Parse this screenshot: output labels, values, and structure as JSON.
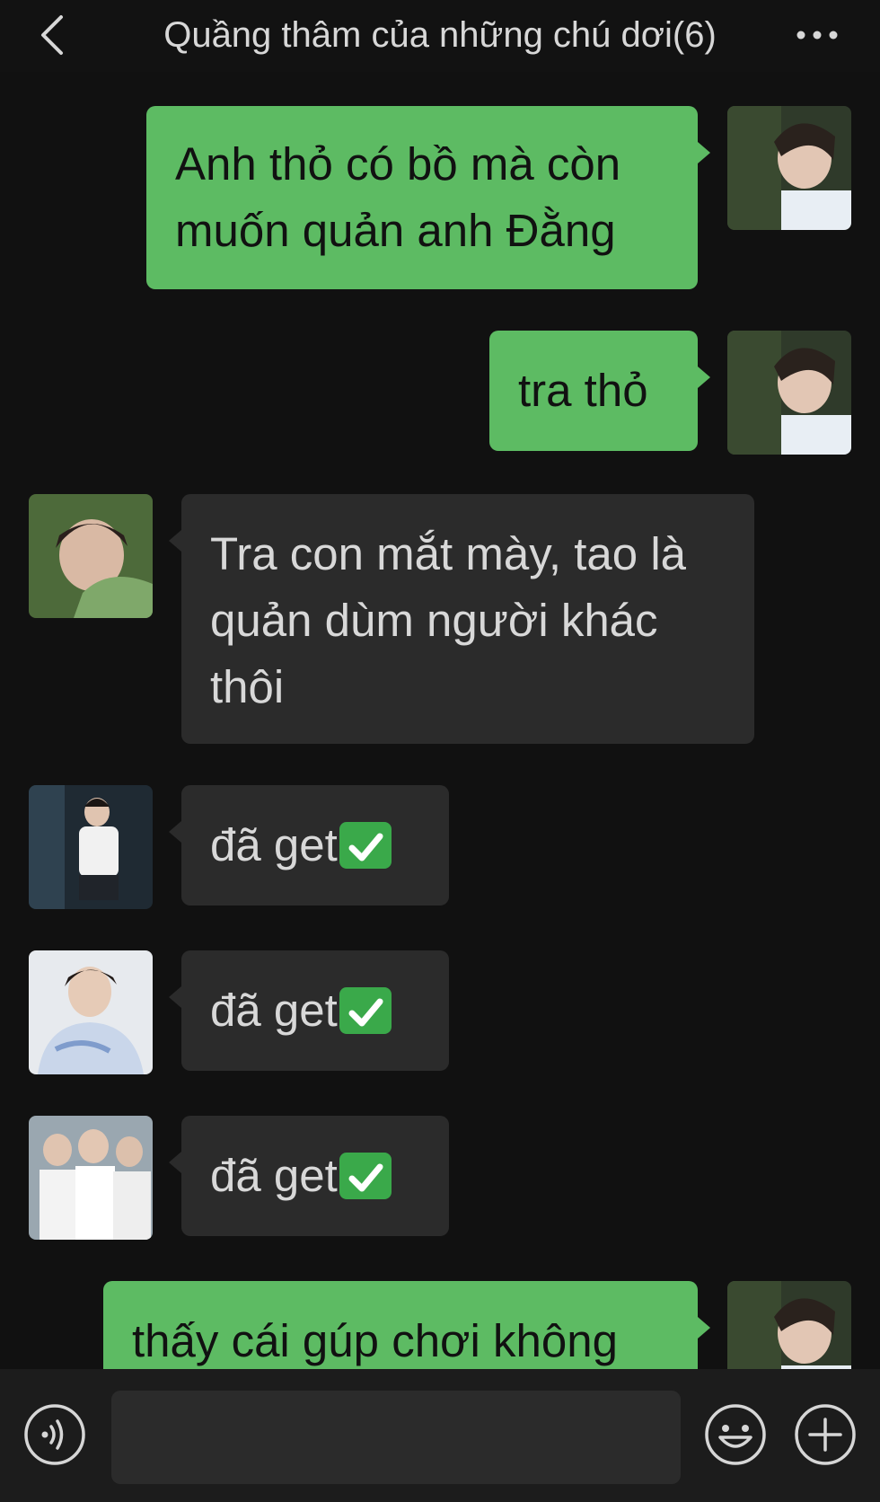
{
  "header": {
    "title": "Quầng thâm của những chú dơi(6)",
    "back_icon": "chevron-left-icon",
    "more_icon": "more-dots-icon"
  },
  "messages": [
    {
      "direction": "outgoing",
      "lines": [
        "Anh thỏ có bồ mà còn",
        "muốn quản anh Đằng"
      ]
    },
    {
      "direction": "outgoing",
      "lines": [
        "tra thỏ"
      ]
    },
    {
      "direction": "incoming",
      "lines": [
        "Tra con mắt mày, tao là",
        "quản dùm người khác",
        "thôi"
      ]
    },
    {
      "direction": "incoming",
      "text": "đã get"
    },
    {
      "direction": "incoming",
      "text": "đã get"
    },
    {
      "direction": "incoming",
      "text": "đã get"
    },
    {
      "direction": "outgoing",
      "lines": [
        "thấy cái gúp chơi không"
      ]
    }
  ],
  "input_bar": {
    "placeholder": "",
    "voice_icon": "voice-icon",
    "emoji_icon": "emoji-icon",
    "plus_icon": "plus-icon"
  },
  "colors": {
    "background": "#111111",
    "outgoing_bubble": "#5dbb63",
    "incoming_bubble": "#2b2b2b",
    "checkmark_emoji": "#3aa94a"
  }
}
